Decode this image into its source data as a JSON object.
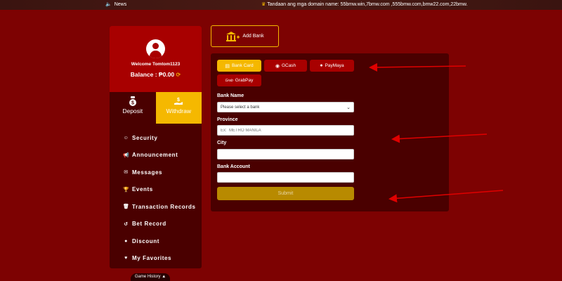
{
  "newsbar": {
    "news_label": "News",
    "ticker_text": "Tandaan ang mga domain name: 55bmw.win,7bmw.com ,555bmw.com,bmw22.com,22bmw."
  },
  "sidebar": {
    "welcome": "Welcome Tomtom1123",
    "balance": "Balance : ₱0.00",
    "deposit_label": "Deposit",
    "withdraw_label": "Withdraw",
    "menu": [
      {
        "label": "Security",
        "icon": "user-shield-icon"
      },
      {
        "label": "Announcement",
        "icon": "megaphone-icon"
      },
      {
        "label": "Messages",
        "icon": "envelope-icon"
      },
      {
        "label": "Events",
        "icon": "trophy-icon"
      },
      {
        "label": "Transaction Records",
        "icon": "trash-icon"
      },
      {
        "label": "Bet Record",
        "icon": "history-icon"
      },
      {
        "label": "Discount",
        "icon": "discount-icon"
      },
      {
        "label": "My Favorites",
        "icon": "heart-icon"
      }
    ],
    "game_history": "Game History ▲"
  },
  "add_bank_label": "Add Bank",
  "tabs": {
    "bank_card": "Bank Card",
    "gcash": "GCash",
    "paymaya": "PayMaya",
    "grab_prefix": "Grab",
    "grabpay": "GrabPay"
  },
  "form": {
    "bank_name_label": "Bank Name",
    "bank_select_value": "Please select a bank",
    "province_label": "Province",
    "province_placeholder": "Ex:  METRO MANILA",
    "city_label": "City",
    "bank_account_label": "Bank Account",
    "submit_label": "Submit"
  },
  "colors": {
    "background": "#7d0202",
    "panel": "#4a0000",
    "accent": "#f5b800",
    "tab": "#a80000"
  }
}
